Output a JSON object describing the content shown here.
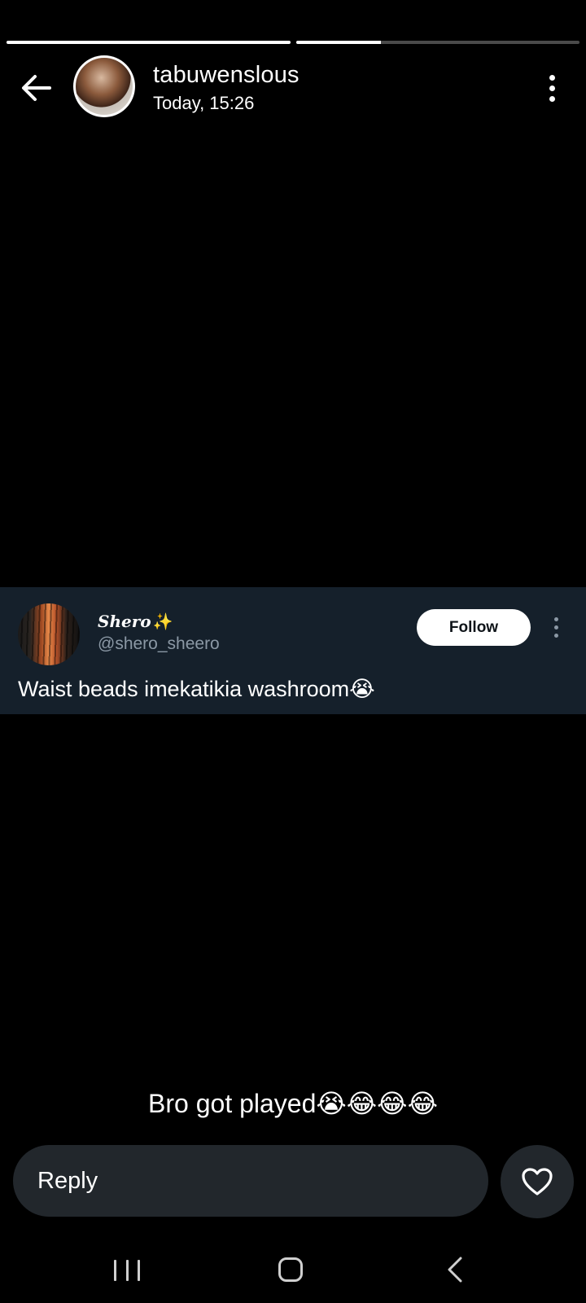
{
  "story": {
    "progress": [
      1.0,
      0.3
    ],
    "username": "tabuwenslous",
    "timestamp": "Today, 15:26",
    "back_icon": "arrow-left-icon",
    "more_icon": "more-vertical-icon"
  },
  "tweet": {
    "display_name": "Shero",
    "display_name_emoji": "✨",
    "handle": "@shero_sheero",
    "follow_label": "Follow",
    "text": "Waist beads imekatikia washroom😭"
  },
  "caption": "Bro got played😭😂😂😂",
  "reply": {
    "placeholder": "Reply",
    "like_icon": "heart-icon"
  },
  "navbar": {
    "recents_icon": "recents-icon",
    "home_icon": "home-icon",
    "back_icon": "back-chevron-icon"
  }
}
